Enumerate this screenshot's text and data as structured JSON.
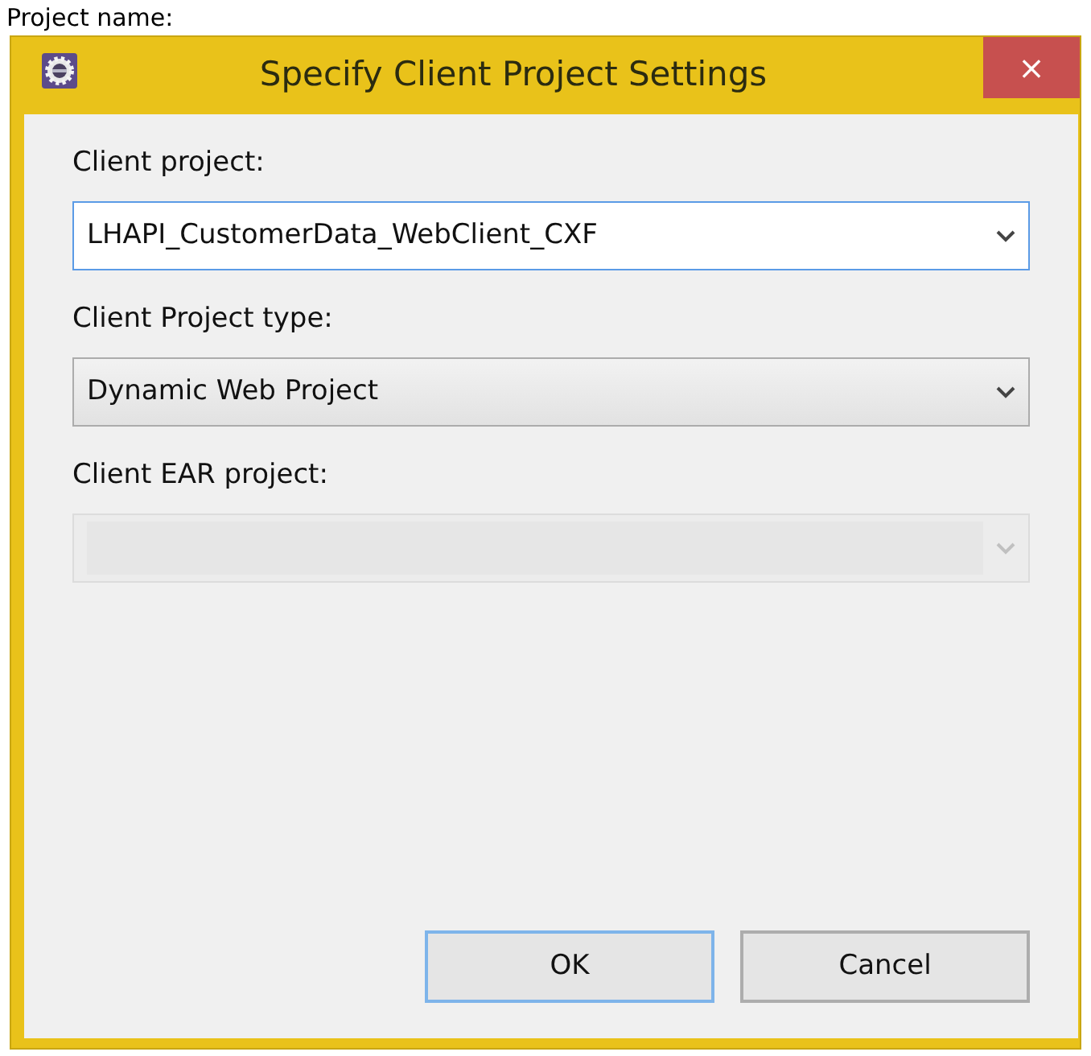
{
  "background_text": "Project name:",
  "window": {
    "title": "Specify Client Project Settings",
    "close": "×"
  },
  "fields": [
    {
      "label": "Client project:",
      "kind": "editable",
      "value": "LHAPI_CustomerData_WebClient_CXF",
      "focused": true,
      "disabled": false
    },
    {
      "label": "Client Project type:",
      "kind": "readonly",
      "value": "Dynamic Web Project",
      "focused": false,
      "disabled": false
    },
    {
      "label": "Client EAR project:",
      "kind": "editable",
      "focused": false,
      "disabled": true
    }
  ],
  "buttons": [
    {
      "label": "OK",
      "default": true
    },
    {
      "label": "Cancel",
      "default": false
    }
  ]
}
